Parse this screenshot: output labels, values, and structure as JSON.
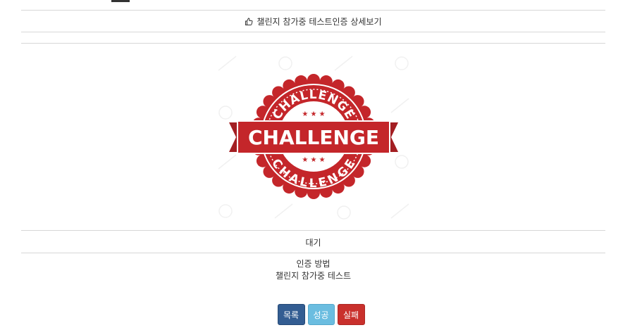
{
  "header": {
    "title": "챌린지 참가중 테스트인증 상세보기",
    "icon": "thumbs-up-icon"
  },
  "certification": {
    "image_text_main": "CHALLENGE",
    "image_text_top": "CHALLENGE",
    "image_text_bottom": "CHALLENGE",
    "status": "대기",
    "method_label": "인증 방법",
    "method_value": "챌린지 참가중 테스트"
  },
  "buttons": {
    "list": "목록",
    "success": "성공",
    "fail": "실패"
  },
  "colors": {
    "accent_red": "#c4262a",
    "list_btn": "#335d92",
    "success_btn": "#6bbde0",
    "fail_btn": "#c9302c"
  }
}
